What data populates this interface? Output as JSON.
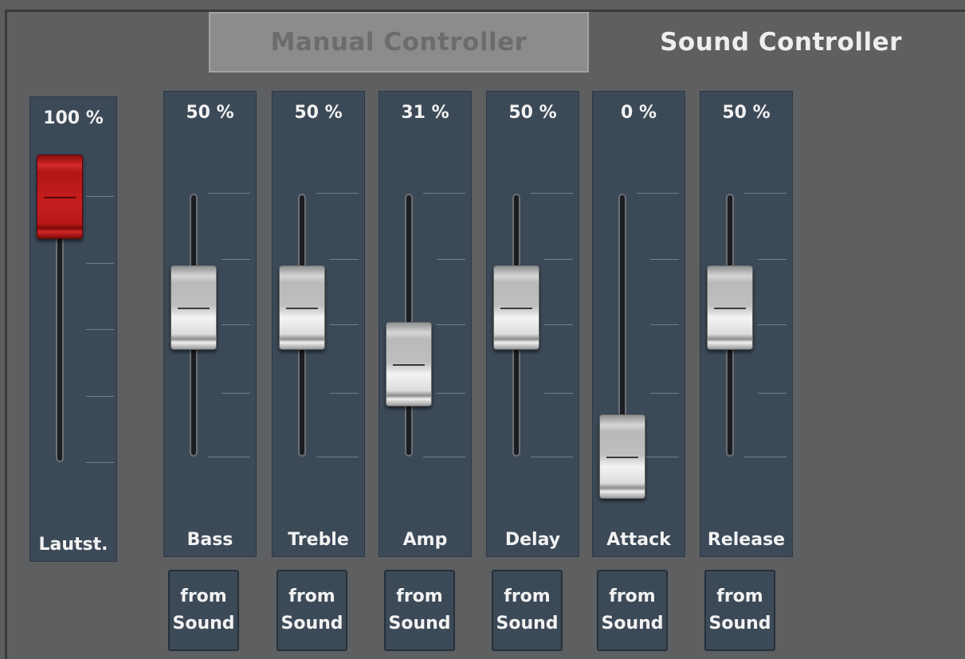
{
  "tabs": {
    "manual_label": "Manual Controller",
    "sound_label": "Sound Controller",
    "active": "Sound Controller"
  },
  "volume": {
    "label": "Lautst.",
    "value_text": "100 %",
    "value": 100,
    "color": "#c41f1f"
  },
  "sliders": [
    {
      "label": "Bass",
      "value_text": "50 %",
      "value": 50,
      "button": "from\nSound"
    },
    {
      "label": "Treble",
      "value_text": "50 %",
      "value": 50,
      "button": "from\nSound"
    },
    {
      "label": "Amp",
      "value_text": "31 %",
      "value": 31,
      "button": "from\nSound"
    },
    {
      "label": "Delay",
      "value_text": "50 %",
      "value": 50,
      "button": "from\nSound"
    },
    {
      "label": "Attack",
      "value_text": "0 %",
      "value": 0,
      "button": "from\nSound"
    },
    {
      "label": "Release",
      "value_text": "50 %",
      "value": 50,
      "button": "from\nSound"
    }
  ]
}
